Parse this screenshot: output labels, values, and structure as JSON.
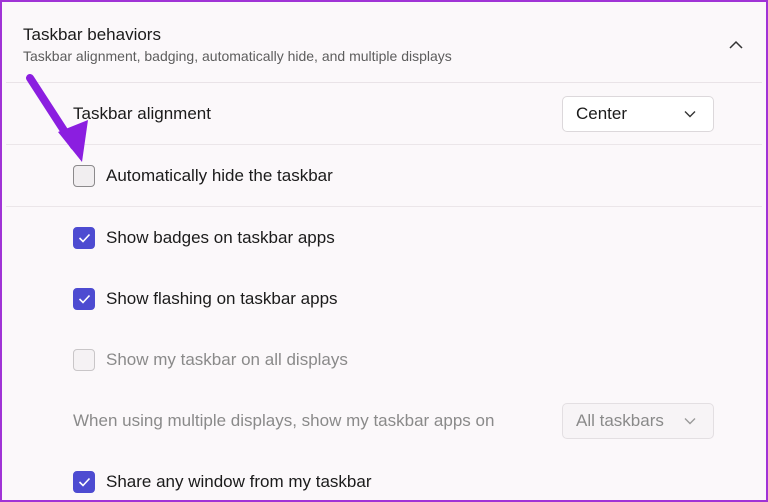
{
  "section": {
    "title": "Taskbar behaviors",
    "subtitle": "Taskbar alignment, badging, automatically hide, and multiple displays",
    "collapse_icon": "chevron-up-icon"
  },
  "alignment": {
    "label": "Taskbar alignment",
    "value": "Center"
  },
  "options": [
    {
      "label": "Automatically hide the taskbar",
      "checked": false,
      "disabled": false
    },
    {
      "label": "Show badges on taskbar apps",
      "checked": true,
      "disabled": false
    },
    {
      "label": "Show flashing on taskbar apps",
      "checked": true,
      "disabled": false
    },
    {
      "label": "Show my taskbar on all displays",
      "checked": false,
      "disabled": true
    }
  ],
  "multi_display": {
    "label": "When using multiple displays, show my taskbar apps on",
    "value": "All taskbars",
    "disabled": true
  },
  "share_window": {
    "label": "Share any window from my taskbar",
    "checked": true
  },
  "colors": {
    "accent": "#4d4bd1",
    "annotation_arrow": "#8b1ee0",
    "frame_border": "#a033d6"
  }
}
